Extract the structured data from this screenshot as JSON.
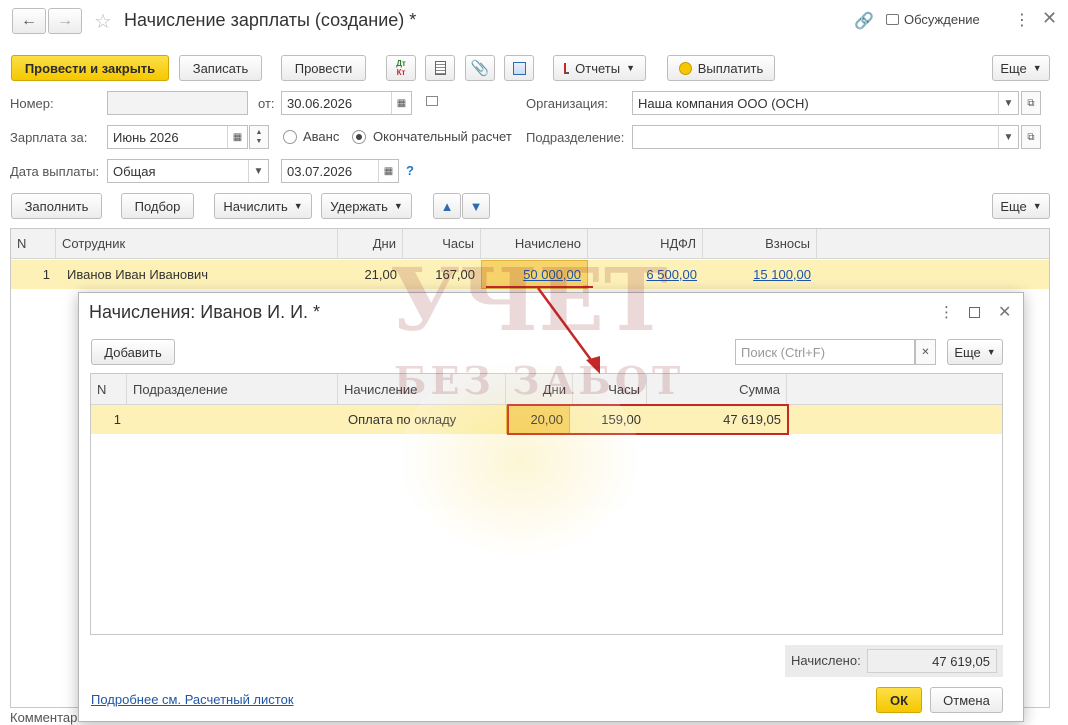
{
  "window": {
    "title": "Начисление зарплаты (создание) *",
    "discussion_label": "Обсуждение"
  },
  "toolbar": {
    "post_close": "Провести и закрыть",
    "save": "Записать",
    "post": "Провести",
    "reports": "Отчеты",
    "pay": "Выплатить",
    "more": "Еще",
    "dtkt_top": "Дт",
    "dtkt_bottom": "Кт"
  },
  "form": {
    "number_label": "Номер:",
    "number_value": "",
    "from_label": "от:",
    "date_value": "30.06.2026",
    "org_label": "Организация:",
    "org_value": "Наша компания ООО (ОСН)",
    "salary_for_label": "Зарплата за:",
    "salary_for_value": "Июнь 2026",
    "advance_label": "Аванс",
    "final_label": "Окончательный расчет",
    "division_label": "Подразделение:",
    "division_value": "",
    "pay_date_label": "Дата выплаты:",
    "pay_date_type": "Общая",
    "pay_date_value": "03.07.2026",
    "help": "?"
  },
  "table_toolbar": {
    "fill": "Заполнить",
    "select": "Подбор",
    "accrue": "Начислить",
    "withhold": "Удержать",
    "more": "Еще"
  },
  "main_table": {
    "headers": [
      "N",
      "Сотрудник",
      "Дни",
      "Часы",
      "Начислено",
      "НДФЛ",
      "Взносы"
    ],
    "rows": [
      {
        "n": "1",
        "employee": "Иванов Иван Иванович",
        "days": "21,00",
        "hours": "167,00",
        "accrued": "50 000,00",
        "ndfl": "6 500,00",
        "contrib": "15 100,00"
      }
    ]
  },
  "modal": {
    "title": "Начисления: Иванов И. И. *",
    "add": "Добавить",
    "search_placeholder": "Поиск (Ctrl+F)",
    "more": "Еще",
    "headers": [
      "N",
      "Подразделение",
      "Начисление",
      "Дни",
      "Часы",
      "Сумма"
    ],
    "rows": [
      {
        "n": "1",
        "division": "",
        "accrual": "Оплата по окладу",
        "days": "20,00",
        "hours": "159,00",
        "sum": "47 619,05"
      }
    ],
    "total_label": "Начислено:",
    "total_value": "47 619,05",
    "footer_link": "Подробнее см. Расчетный листок",
    "ok": "ОК",
    "cancel": "Отмена"
  },
  "bottom": {
    "comment_label": "Комментар"
  },
  "watermark": {
    "line1": "УЧЕТ",
    "line2": "БЕЗ ЗАБОТ"
  },
  "colors": {
    "primary": "#f5c800",
    "selected_row": "#fdf1b8",
    "link": "#1f55a6",
    "highlight_border": "#c62828"
  }
}
